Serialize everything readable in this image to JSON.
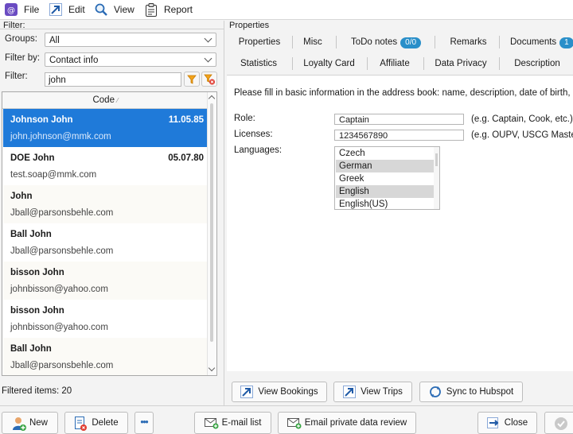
{
  "menubar": {
    "items": [
      {
        "label": "File",
        "icon": "app-icon"
      },
      {
        "label": "Edit",
        "icon": "edit-arrow-icon"
      },
      {
        "label": "View",
        "icon": "magnifier-icon"
      },
      {
        "label": "Report",
        "icon": "clipboard-icon"
      }
    ]
  },
  "filter": {
    "section_label": "Filter:",
    "groups_label": "Groups:",
    "groups_value": "All",
    "filterby_label": "Filter by:",
    "filterby_value": "Contact info",
    "filter_label": "Filter:",
    "filter_value": "john"
  },
  "list": {
    "column_header": "Code",
    "rows": [
      {
        "name": "Johnson John",
        "date": "11.05.85",
        "email": "john.johnson@mmk.com",
        "selected": true
      },
      {
        "name": "DOE John",
        "date": "05.07.80",
        "email": "test.soap@mmk.com"
      },
      {
        "name": "John",
        "date": "",
        "email": "Jball@parsonsbehle.com"
      },
      {
        "name": "Ball John",
        "date": "",
        "email": "Jball@parsonsbehle.com"
      },
      {
        "name": "bisson John",
        "date": "",
        "email": "johnbisson@yahoo.com"
      },
      {
        "name": "bisson John",
        "date": "",
        "email": "johnbisson@yahoo.com"
      },
      {
        "name": "Ball John",
        "date": "",
        "email": "Jball@parsonsbehle.com"
      }
    ],
    "filtered_items": "Filtered items: 20"
  },
  "properties": {
    "section_label": "Properties",
    "tabs_row1": [
      "Properties",
      "Misc",
      "ToDo notes",
      "Remarks",
      "Documents"
    ],
    "todo_badge": "0/0",
    "documents_badge": "1",
    "tabs_row2": [
      "Statistics",
      "Loyalty Card",
      "Affiliate",
      "Data Privacy",
      "Description"
    ],
    "intro": "Please fill in basic information in the address book: name, description, date of birth, nati",
    "role_label": "Role:",
    "role_value": "Captain",
    "role_hint": "(e.g. Captain, Cook, etc.)",
    "licenses_label": "Licenses:",
    "licenses_value": "1234567890",
    "licenses_hint": "(e.g. OUPV, USCG Master, et",
    "languages_label": "Languages:",
    "languages": [
      {
        "name": "Czech",
        "selected": false
      },
      {
        "name": "German",
        "selected": true
      },
      {
        "name": "Greek",
        "selected": false
      },
      {
        "name": "English",
        "selected": true
      },
      {
        "name": "English(US)",
        "selected": false
      }
    ]
  },
  "actions": {
    "view_bookings": "View Bookings",
    "view_trips": "View Trips",
    "sync_hubspot": "Sync to Hubspot"
  },
  "bottombar": {
    "new": "New",
    "delete": "Delete",
    "more": "•••",
    "email_list": "E-mail list",
    "email_review": "Email private data review",
    "close": "Close"
  },
  "colors": {
    "selection": "#1f7ad9",
    "badge": "#2a8fc9",
    "accent_blue": "#1f5aa6"
  }
}
